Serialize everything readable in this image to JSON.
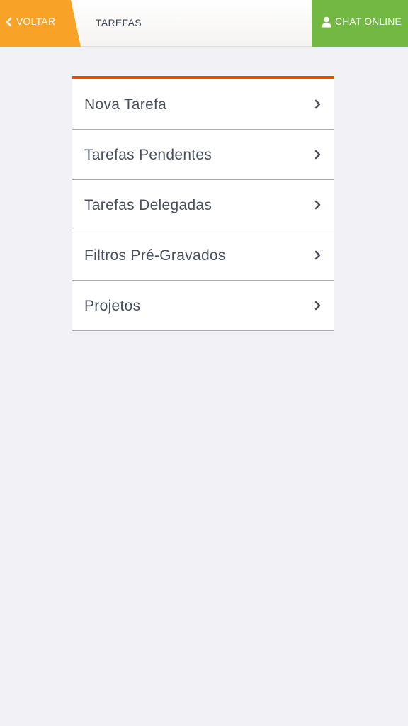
{
  "header": {
    "back_label": "VOLTAR",
    "title": "TAREFAS",
    "chat_label": "CHAT ONLINE"
  },
  "colors": {
    "back_button": "#f9a228",
    "chat_button": "#72b843",
    "menu_accent": "#d9560f",
    "background": "#f1f1f6",
    "menu_text": "#46505e"
  },
  "icons": {
    "back": "chevron-left-icon",
    "chat": "user-icon",
    "menu_item": "chevron-right-icon"
  },
  "menu": {
    "items": [
      {
        "label": "Nova Tarefa"
      },
      {
        "label": "Tarefas Pendentes"
      },
      {
        "label": "Tarefas Delegadas"
      },
      {
        "label": "Filtros Pré-Gravados"
      },
      {
        "label": "Projetos"
      }
    ]
  }
}
